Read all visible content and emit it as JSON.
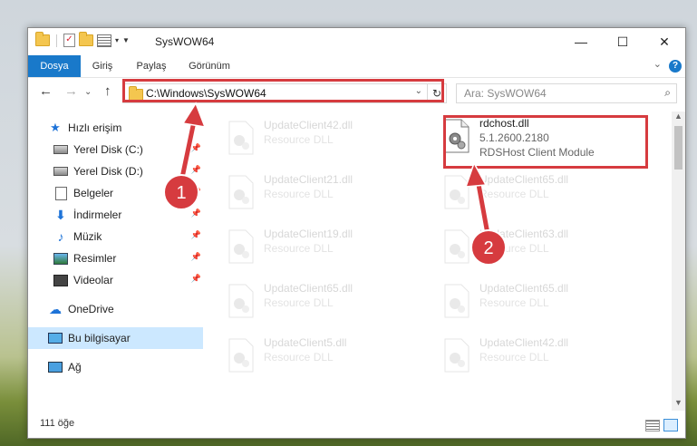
{
  "window": {
    "title": "SysWOW64"
  },
  "ribbon": {
    "tabs": [
      "Dosya",
      "Giriş",
      "Paylaş",
      "Görünüm"
    ],
    "help": "?"
  },
  "nav": {
    "address": "C:\\Windows\\SysWOW64",
    "search_placeholder": "Ara: SysWOW64"
  },
  "sidebar": {
    "items": [
      {
        "label": "Hızlı erişim",
        "icon": "star-icon"
      },
      {
        "label": "Yerel Disk (C:)",
        "icon": "drive-icon",
        "pinned": true
      },
      {
        "label": "Yerel Disk (D:)",
        "icon": "drive-icon",
        "pinned": true
      },
      {
        "label": "Belgeler",
        "icon": "documents-icon",
        "pinned": true
      },
      {
        "label": "İndirmeler",
        "icon": "downloads-icon",
        "pinned": true
      },
      {
        "label": "Müzik",
        "icon": "music-icon",
        "pinned": true
      },
      {
        "label": "Resimler",
        "icon": "pictures-icon",
        "pinned": true
      },
      {
        "label": "Videolar",
        "icon": "videos-icon",
        "pinned": true
      },
      {
        "label": "OneDrive",
        "icon": "onedrive-icon"
      },
      {
        "label": "Bu bilgisayar",
        "icon": "this-pc-icon",
        "selected": true
      },
      {
        "label": "Ağ",
        "icon": "network-icon"
      }
    ]
  },
  "files": {
    "target": {
      "name": "rdchost.dll",
      "version": "5.1.2600.2180",
      "description": "RDSHost Client Module"
    },
    "left_column": [
      {
        "name": "UpdateClient42.dll",
        "type": "Resource DLL"
      },
      {
        "name": "UpdateClient21.dll",
        "type": "Resource DLL"
      },
      {
        "name": "UpdateClient19.dll",
        "type": "Resource DLL"
      },
      {
        "name": "UpdateClient65.dll",
        "type": "Resource DLL"
      },
      {
        "name": "UpdateClient5.dll",
        "type": "Resource DLL"
      }
    ],
    "right_column": [
      {
        "name": "UpdateClient65.dll",
        "type": "Resource DLL"
      },
      {
        "name": "UpdateClient63.dll",
        "type": "Resource DLL"
      },
      {
        "name": "UpdateClient65.dll",
        "type": "Resource DLL"
      },
      {
        "name": "UpdateClient42.dll",
        "type": "Resource DLL"
      }
    ]
  },
  "status": {
    "count": "111 öğe"
  },
  "annotations": {
    "step1": "1",
    "step2": "2",
    "color": "#d63b3f"
  }
}
